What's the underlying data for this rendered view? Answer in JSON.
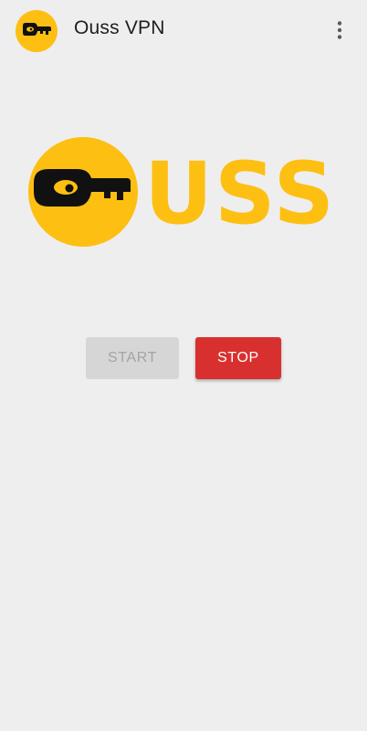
{
  "app_bar": {
    "title": "Ouss VPN",
    "icon": "ouss-key-logo-icon",
    "menu_icon": "more-vert-icon"
  },
  "logo": {
    "text": "USS",
    "icon": "key-circle-icon"
  },
  "controls": {
    "start_label": "START",
    "stop_label": "STOP",
    "start_enabled": false,
    "stop_enabled": true
  },
  "colors": {
    "brand_yellow": "#fdbf12",
    "key_black": "#111111",
    "stop_red": "#d8302f",
    "disabled_gray": "#d6d6d6",
    "background": "#eeeeee"
  }
}
